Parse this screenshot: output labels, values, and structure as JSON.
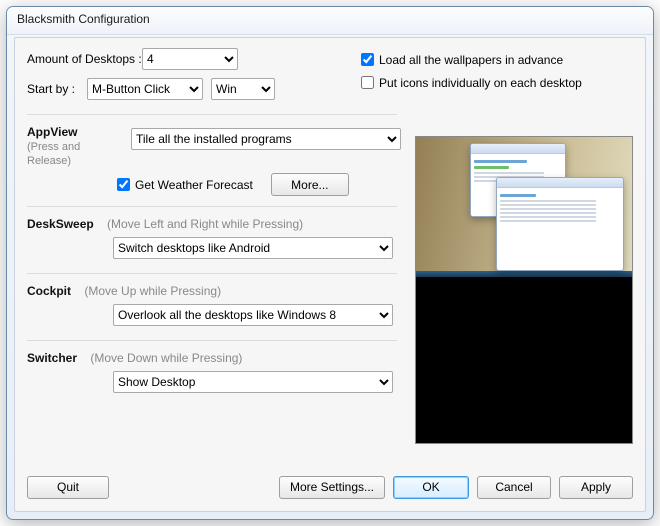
{
  "window": {
    "title": "Blacksmith Configuration"
  },
  "top": {
    "amount_label": "Amount of Desktops :",
    "amount_value": "4",
    "startby_label": "Start by :",
    "startby_value": "M-Button Click",
    "modifier_value": "Win",
    "load_wallpapers_label": "Load all the wallpapers in advance",
    "load_wallpapers_checked": true,
    "put_icons_label": "Put icons individually on each desktop",
    "put_icons_checked": false
  },
  "appview": {
    "title": "AppView",
    "hint": "(Press and Release)",
    "select_value": "Tile all the installed programs",
    "weather_label": "Get Weather Forecast",
    "weather_checked": true,
    "more_label": "More..."
  },
  "desksweep": {
    "title": "DeskSweep",
    "hint": "(Move Left and Right while Pressing)",
    "select_value": "Switch desktops like Android"
  },
  "cockpit": {
    "title": "Cockpit",
    "hint": "(Move Up while Pressing)",
    "select_value": "Overlook all the desktops like Windows 8"
  },
  "switcher": {
    "title": "Switcher",
    "hint": "(Move Down while Pressing)",
    "select_value": "Show Desktop"
  },
  "footer": {
    "quit": "Quit",
    "more_settings": "More Settings...",
    "ok": "OK",
    "cancel": "Cancel",
    "apply": "Apply"
  }
}
